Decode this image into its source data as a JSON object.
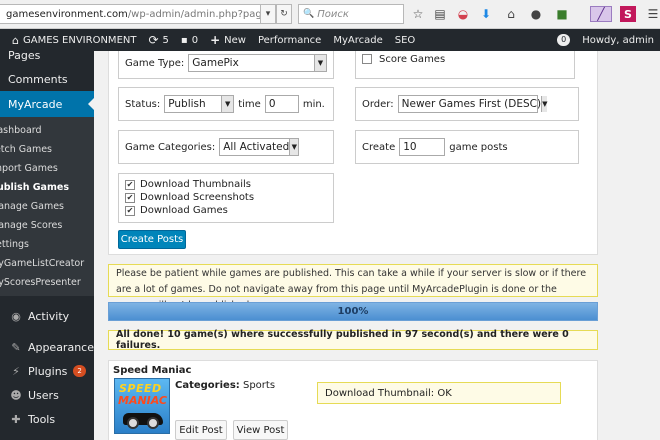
{
  "browser": {
    "url_host": "gamesenvironment.com",
    "url_path": "/wp-admin/admin.php?page=myarcade",
    "search_placeholder": "Поиск",
    "icons": [
      "star-icon",
      "reading-list-icon",
      "pocket-icon",
      "download-icon",
      "home-icon",
      "chat-icon",
      "extension-icon",
      "pen-icon",
      "s-logo-icon",
      "menu-icon"
    ]
  },
  "adminbar": {
    "site_name": "GAMES ENVIRONMENT",
    "updates_count": "5",
    "comments_count": "0",
    "new_label": "New",
    "performance_label": "Performance",
    "myarcade_label": "MyArcade",
    "seo_label": "SEO",
    "notif_count": "0",
    "howdy": "Howdy, admin"
  },
  "sidebar": {
    "top_items": [
      "Pages",
      "Comments"
    ],
    "active_item": "MyArcade",
    "sub_items": [
      "Dashboard",
      "Fetch Games",
      "Import Games",
      "Publish Games",
      "Manage Games",
      "Manage Scores",
      "Settings",
      "MyGameListCreator",
      "MyScoresPresenter"
    ],
    "current_sub": "Publish Games",
    "bottom_items": [
      "Activity",
      "Appearance",
      "Plugins",
      "Users",
      "Tools"
    ],
    "plugins_badge": "2"
  },
  "form": {
    "game_type_label": "Game Type:",
    "game_type_value": "GamePix",
    "score_games_label": "Score Games",
    "status_label": "Status:",
    "status_value": "Publish",
    "time_label": "time",
    "time_value": "0",
    "min_label": "min.",
    "order_label": "Order:",
    "order_value": "Newer Games First (DESC)",
    "categories_label": "Game Categories:",
    "categories_value": "All Activated",
    "create_label": "Create",
    "create_value": "10",
    "game_posts_label": "game posts",
    "checkboxes": [
      "Download Thumbnails",
      "Download Screenshots",
      "Download Games"
    ],
    "create_button": "Create Posts"
  },
  "notice_text": "Please be patient while games are published. This can take a while if your server is slow or if there are a lot of games. Do not navigate away from this page until MyArcadePlugin is done or the games will not be published.",
  "progress": {
    "label": "100%",
    "value": 1.0
  },
  "success_text": "All done! 10 game(s) where successfully published in 97 second(s) and there were 0 failures.",
  "game": {
    "title": "Speed Maniac",
    "thumb_line1": "SPEED",
    "thumb_line2": "MANIAC",
    "categories_label": "Categories:",
    "categories_value": "Sports",
    "download_note": "Download Thumbnail: OK",
    "edit_button": "Edit Post",
    "view_button": "View Post"
  },
  "colors": {
    "admin_dark": "#23282d",
    "accent_blue": "#0073aa",
    "notice_bg": "#fefbe6",
    "notice_border": "#e6db55",
    "progress_blue": "#4b8fd1"
  }
}
